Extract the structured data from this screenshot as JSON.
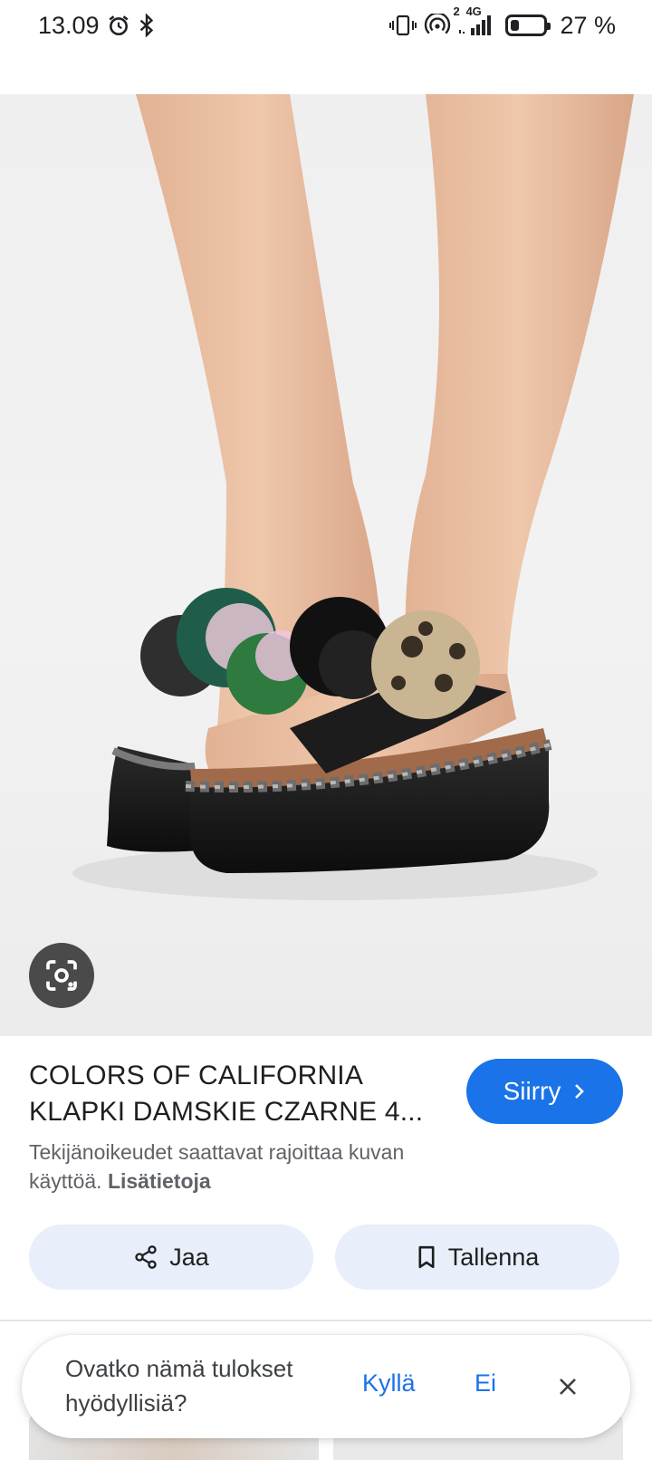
{
  "status_bar": {
    "time": "13.09",
    "network_label": "4G",
    "sim_label": "2",
    "battery_text": "27 %",
    "battery_level": 0.27,
    "icons": [
      "alarm-icon",
      "bluetooth-icon",
      "vibrate-icon",
      "hotspot-icon",
      "signal-icon",
      "battery-icon"
    ]
  },
  "result": {
    "title_line1": "COLORS OF CALIFORNIA",
    "title_line2": "KLAPKI DAMSKIE CZARNE 4...",
    "go_label": "Siirry",
    "copyright_text": "Tekijänoikeudet saattavat rajoittaa kuvan käyttöä.",
    "more_info_label": "Lisätietoja",
    "share_label": "Jaa",
    "save_label": "Tallenna"
  },
  "feedback": {
    "question": "Ovatko nämä tulokset hyödyllisiä?",
    "yes_label": "Kyllä",
    "no_label": "Ei"
  },
  "colors": {
    "accent": "#1a73e8",
    "button_bg": "#e8effa",
    "secondary_text": "#5f6368"
  }
}
